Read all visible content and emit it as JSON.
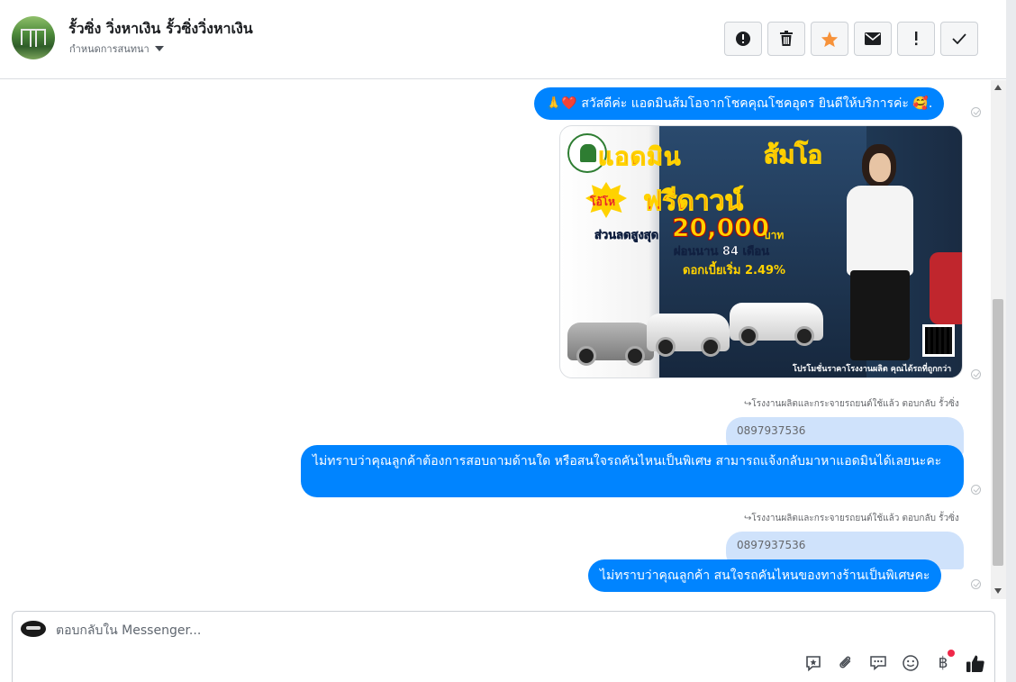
{
  "header": {
    "page_name": "รั้วซิ่ง วิ่งหาเงิน รั้วซิ่งวิ่งหาเงิน",
    "assign_label": "กำหนดการสนทนา",
    "actions": [
      {
        "name": "report-button",
        "icon": "alert-circle-icon"
      },
      {
        "name": "delete-button",
        "icon": "trash-icon"
      },
      {
        "name": "star-button",
        "icon": "star-icon"
      },
      {
        "name": "mark-unread-button",
        "icon": "envelope-icon"
      },
      {
        "name": "important-button",
        "icon": "exclamation-icon"
      },
      {
        "name": "mark-done-button",
        "icon": "checkmark-icon"
      }
    ],
    "star_color": "#f7923a"
  },
  "messages": {
    "greeting": "🙏❤️ สวัสดีค่ะ แอดมินส้มโอจากโชคคุณโชคอุดร ยินดีให้บริการค่ะ 🥰.",
    "promo_image": {
      "headline_1": "แอดมิน",
      "headline_2": "ส้มโอ",
      "burst": "โอ้โห",
      "free_down": "ฟรีดาวน์",
      "discount_label": "ส่วนลดสูงสุด",
      "discount_amount": "20,000",
      "currency": "บาท",
      "installment": "ผ่อนนาน 84 เดือน",
      "interest": "ดอกเบี้ยเริ่ม 2.49%",
      "footer": "โปรโมชั่นราคาโรงงานผลิต คุณได้รถที่ถูกกว่า"
    },
    "replied_1": "โรงงานผลิตและกระจายรถยนต์ใช้แล้ว ตอบกลับ รั้วซิ่ง",
    "quoted_1": "0897937536",
    "reply_1": "ไม่ทราบว่าคุณลูกค้าต้องการสอบถามด้านใด หรือสนใจรถคันไหนเป็นพิเศษ สามารถแจ้งกลับมาหาแอดมินได้เลยนะคะ",
    "replied_2": "โรงงานผลิตและกระจายรถยนต์ใช้แล้ว ตอบกลับ รั้วซิ่ง",
    "quoted_2": "0897937536",
    "reply_2": "ไม่ทราบว่าคุณลูกค้า สนใจรถคันไหนของทางร้านเป็นพิเศษคะ",
    "bubble_color": "#0084ff"
  },
  "composer": {
    "placeholder": "ตอบกลับใน Messenger...",
    "tools": [
      "saved-reply-icon",
      "attachment-icon",
      "chat-bubbles-icon",
      "emoji-icon",
      "baht-payment-icon",
      "thumbs-up-icon"
    ],
    "baht_symbol": "฿"
  }
}
